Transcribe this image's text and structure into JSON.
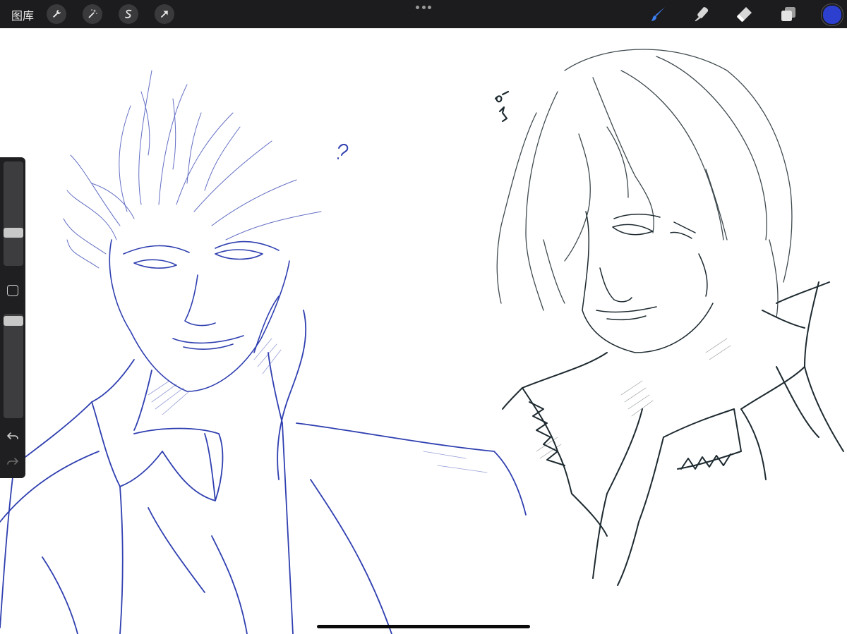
{
  "toolbar": {
    "gallery_label": "图库",
    "left_tools": [
      "wrench-icon",
      "magic-wand-icon",
      "selection-s-icon",
      "transform-arrow-icon"
    ],
    "right_tools": [
      "brush-icon",
      "smudge-icon",
      "eraser-icon",
      "layers-icon"
    ],
    "active_tool": "brush-icon",
    "current_color": "#2c3fce"
  },
  "sidebar": {
    "brush_size_level": 0.32,
    "opacity_level": 0.95,
    "icons": [
      "modify-square-icon",
      "undo-icon",
      "redo-icon"
    ]
  },
  "canvas": {
    "annotation_left": "?",
    "sketch_colors": {
      "left": "#2f3fb0",
      "right": "#1d2a30"
    }
  }
}
